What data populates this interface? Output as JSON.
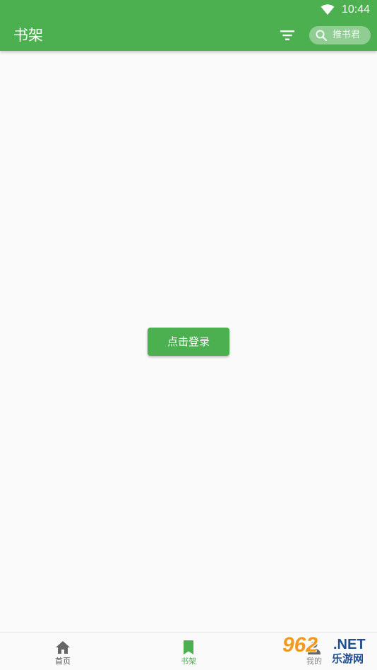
{
  "status_bar": {
    "time": "10:44"
  },
  "header": {
    "title": "书架",
    "search_placeholder": "推书君"
  },
  "main": {
    "login_button": "点击登录"
  },
  "bottom_nav": {
    "items": [
      {
        "label": "首页",
        "icon": "home-icon"
      },
      {
        "label": "书架",
        "icon": "bookmark-icon",
        "active": true
      },
      {
        "label": "我的",
        "icon": "person-icon"
      }
    ]
  },
  "watermark": {
    "number": "962",
    "suffix": ".NET",
    "text": "乐游网"
  },
  "colors": {
    "primary": "#4caf50",
    "background": "#fafafa"
  }
}
